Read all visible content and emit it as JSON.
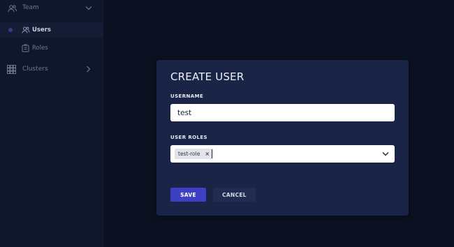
{
  "sidebar": {
    "team": {
      "label": "Team",
      "icon": "team-icon",
      "expanded": true
    },
    "users": {
      "label": "Users",
      "icon": "users-icon",
      "active": true
    },
    "roles": {
      "label": "Roles",
      "icon": "roles-icon"
    },
    "clusters": {
      "label": "Clusters",
      "icon": "grid-icon",
      "expanded": false
    }
  },
  "modal": {
    "title": "CREATE USER",
    "username_label": "USERNAME",
    "username_value": "test",
    "roles_label": "USER ROLES",
    "selected_roles": [
      "test-role"
    ],
    "remove_chip_glyph": "×",
    "save_label": "SAVE",
    "cancel_label": "CANCEL"
  },
  "colors": {
    "page_background": "#0b1120",
    "sidebar_background": "#10172a",
    "modal_background": "#1a2446",
    "primary_button": "#3d3fc4",
    "secondary_button": "#212c52",
    "active_indicator": "#2f3d8a"
  }
}
